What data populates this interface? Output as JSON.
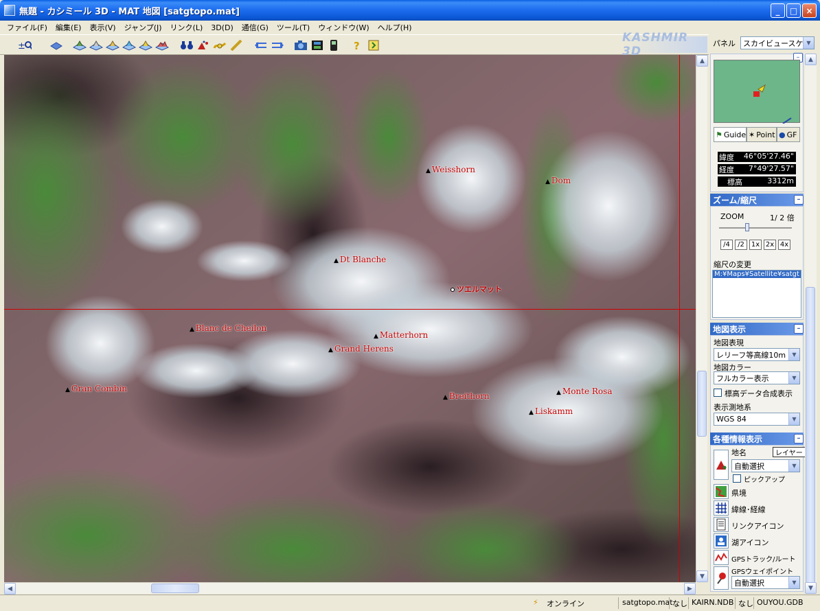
{
  "window": {
    "title": "無題 - カシミール 3D - MAT 地図 [satgtopo.mat]",
    "minimize": "_",
    "maximize": "□",
    "close": "×"
  },
  "menu": [
    "ファイル(F)",
    "編集(E)",
    "表示(V)",
    "ジャンプ(J)",
    "リンク(L)",
    "3D(D)",
    "通信(G)",
    "ツール(T)",
    "ウィンドウ(W)",
    "ヘルプ(H)"
  ],
  "toolbar": {
    "logo": "KASHMIR 3D",
    "icons": [
      "zoom-in-out-icon",
      "layer-icon",
      "map-icon",
      "map-icon",
      "map-icon",
      "map-icon",
      "map-icon",
      "map-icon",
      "binoculars-icon",
      "mountain-icon",
      "route-icon",
      "ruler-icon",
      "back-icon",
      "forward-icon",
      "camera-icon",
      "film-icon",
      "gps-icon",
      "help-icon",
      "exit-icon"
    ]
  },
  "map": {
    "peaks": [
      {
        "name": "Weisshorn"
      },
      {
        "name": "Dom"
      },
      {
        "name": "Dt Blanche"
      },
      {
        "name": "Blanc de Cheilon"
      },
      {
        "name": "Matterhorn"
      },
      {
        "name": "Grand Herens"
      },
      {
        "name": "Gran Combin"
      },
      {
        "name": "Breithorn"
      },
      {
        "name": "Monte Rosa"
      },
      {
        "name": "Liskamm"
      }
    ],
    "town": "ツエルマット"
  },
  "status": {
    "online": "オンライン",
    "map_file": "satgtopo.mat",
    "none1": "なし",
    "db1": "KAIRN.NDB",
    "none2": "なし",
    "db2": "OUYOU.GDB"
  },
  "panel": {
    "label": "パネル",
    "selected": "スカイビュースケ",
    "tabs": [
      "Guide",
      "Point",
      "GF"
    ],
    "coords": [
      {
        "k": "緯度",
        "v": "46°05'27.46\""
      },
      {
        "k": "経度",
        "v": "7°49'27.57\""
      },
      {
        "k": "標高",
        "v": "3312m"
      }
    ],
    "zoom_section": {
      "title": "ズーム/縮尺",
      "zoom_label": "ZOOM",
      "zoom_value": "1/ 2 倍",
      "buttons": [
        "/4",
        "/2",
        "1x",
        "2x",
        "4x"
      ],
      "scale_label": "縮尺の変更",
      "scale_path": "M:¥Maps¥Satellite¥satgt"
    },
    "map_display": {
      "title": "地図表示",
      "expr_label": "地図表現",
      "expr_value": "レリーフ等高線10m",
      "color_label": "地図カラー",
      "color_value": "フルカラー表示",
      "elev_label": "標高データ合成表示",
      "datum_label": "表示測地系",
      "datum_value": "WGS 84"
    },
    "info": {
      "title": "各種情報表示",
      "chimei": "地名",
      "layer_btn": "レイヤー",
      "auto1": "自動選択",
      "pickup": "ピックアップ",
      "items": [
        "県境",
        "緯線･経線",
        "リンクアイコン",
        "湖アイコン",
        "GPSトラック/ルート",
        "GPSウェイポイント"
      ],
      "auto2": "自動選択"
    }
  }
}
